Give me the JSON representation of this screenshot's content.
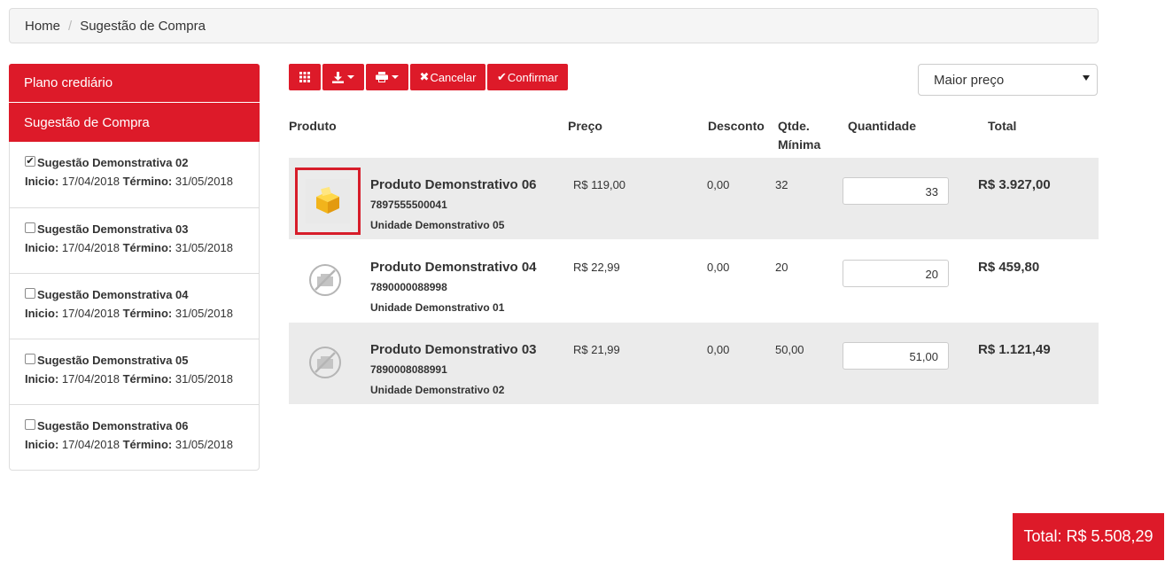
{
  "breadcrumb": {
    "home": "Home",
    "separator": "/",
    "current": "Sugestão de Compra"
  },
  "sidebar": {
    "plano_label": "Plano crediário",
    "sugestao_label": "Sugestão de Compra",
    "items": [
      {
        "name": "Sugestão Demonstrativa 02",
        "checked": true,
        "inicio_label": "Inicio:",
        "inicio": "17/04/2018",
        "termino_label": "Término:",
        "termino": "31/05/2018"
      },
      {
        "name": "Sugestão Demonstrativa 03",
        "checked": false,
        "inicio_label": "Inicio:",
        "inicio": "17/04/2018",
        "termino_label": "Término:",
        "termino": "31/05/2018"
      },
      {
        "name": "Sugestão Demonstrativa 04",
        "checked": false,
        "inicio_label": "Inicio:",
        "inicio": "17/04/2018",
        "termino_label": "Término:",
        "termino": "31/05/2018"
      },
      {
        "name": "Sugestão Demonstrativa 05",
        "checked": false,
        "inicio_label": "Inicio:",
        "inicio": "17/04/2018",
        "termino_label": "Término:",
        "termino": "31/05/2018"
      },
      {
        "name": "Sugestão Demonstrativa 06",
        "checked": false,
        "inicio_label": "Inicio:",
        "inicio": "17/04/2018",
        "termino_label": "Término:",
        "termino": "31/05/2018"
      }
    ]
  },
  "toolbar": {
    "grid_icon": "grid-icon",
    "download_icon": "download-icon",
    "print_icon": "print-icon",
    "cancel_label": "Cancelar",
    "confirm_label": "Confirmar"
  },
  "sort": {
    "selected": "Maior preço"
  },
  "table": {
    "headers": {
      "produto": "Produto",
      "preco": "Preço",
      "desconto": "Desconto",
      "qtde_min_1": "Qtde.",
      "qtde_min_2": "Mínima",
      "quantidade": "Quantidade",
      "total": "Total"
    },
    "rows": [
      {
        "name": "Produto Demonstrativo 06",
        "code": "7897555500041",
        "unit": "Unidade Demonstrativo 05",
        "price": "R$ 119,00",
        "discount": "0,00",
        "min_qty": "32",
        "quantity": "33",
        "total": "R$ 3.927,00",
        "image": "product-box-icon"
      },
      {
        "name": "Produto Demonstrativo 04",
        "code": "7890000088998",
        "unit": "Unidade Demonstrativo 01",
        "price": "R$ 22,99",
        "discount": "0,00",
        "min_qty": "20",
        "quantity": "20",
        "total": "R$ 459,80",
        "image": "no-image-icon"
      },
      {
        "name": "Produto Demonstrativo 03",
        "code": "7890008088991",
        "unit": "Unidade Demonstrativo 02",
        "price": "R$ 21,99",
        "discount": "0,00",
        "min_qty": "50,00",
        "quantity": "51,00",
        "total": "R$ 1.121,49",
        "image": "no-image-icon"
      }
    ]
  },
  "total": "Total: R$ 5.508,29",
  "colors": {
    "accent": "#dd1a29",
    "row_grey": "#ebebeb"
  }
}
